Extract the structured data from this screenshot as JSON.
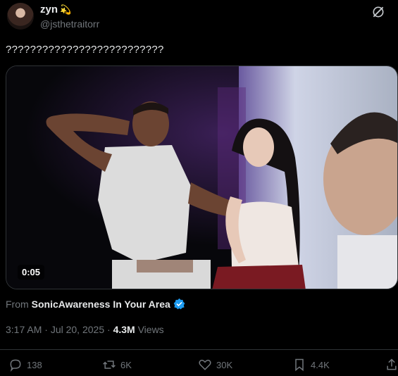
{
  "author": {
    "name": "zyn",
    "name_emoji": "💫",
    "handle": "@jsthetraitorr"
  },
  "tweet": {
    "text": "??????????????????????????"
  },
  "media": {
    "duration": "0:05"
  },
  "source": {
    "prefix": "From",
    "account": "SonicAwareness In Your Area"
  },
  "meta": {
    "time": "3:17 AM",
    "separator": " · ",
    "date": "Jul 20, 2025",
    "sep2": " · ",
    "views_count": "4.3M",
    "views_label": " Views"
  },
  "actions": {
    "replies": "138",
    "reposts": "6K",
    "likes": "30K",
    "bookmarks": "4.4K"
  },
  "colors": {
    "verified": "#1d9bf0",
    "muted": "#71767b",
    "text": "#e7e9ea",
    "skirt": "#7a1a22"
  }
}
